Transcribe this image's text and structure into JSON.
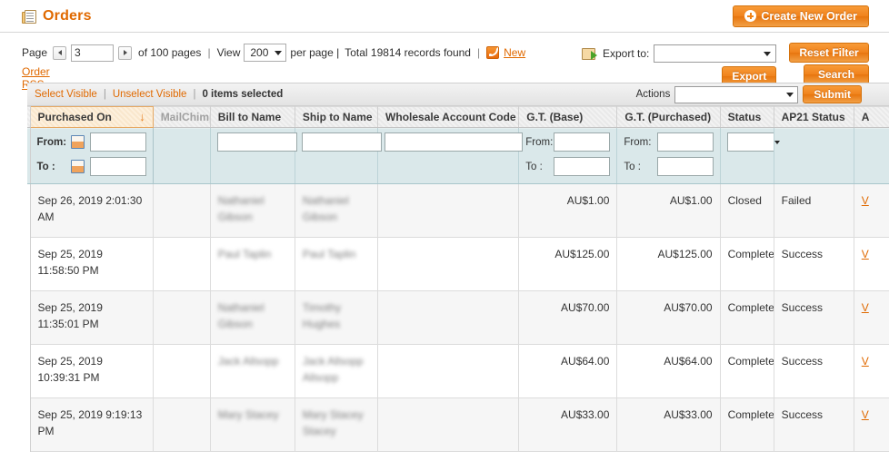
{
  "header": {
    "title": "Orders",
    "icon": "orders-page-icon",
    "create_button": "Create New Order"
  },
  "pager": {
    "page_label": "Page",
    "prev_icon": "prev-page-icon",
    "next_icon": "next-page-icon",
    "page_value": "3",
    "of_pages": "of 100 pages",
    "sep": "|",
    "view_label": "View",
    "per_page_value": "200",
    "per_page_label": "per page |",
    "total_records": "Total 19814 records found",
    "sep2": "|",
    "rss_new": "New",
    "order_rss": "Order RSS"
  },
  "export": {
    "icon": "export-icon",
    "label": "Export to:",
    "select_value": "",
    "button": "Export"
  },
  "filter_buttons": {
    "reset": "Reset Filter",
    "search": "Search"
  },
  "massaction": {
    "select_visible": "Select Visible",
    "divider": "|",
    "unselect_visible": "Unselect Visible",
    "divider2": "|",
    "items_selected": "0 items selected",
    "actions_label": "Actions",
    "actions_value": "",
    "submit": "Submit"
  },
  "grid": {
    "columns": [
      {
        "label": "Purchased On",
        "sorted": true,
        "sort_dir": "↓",
        "muted": false
      },
      {
        "label": "MailChimp",
        "sorted": false,
        "muted": true
      },
      {
        "label": "Bill to Name",
        "sorted": false,
        "muted": false
      },
      {
        "label": "Ship to Name",
        "sorted": false,
        "muted": false
      },
      {
        "label": "Wholesale Account Code",
        "sorted": false,
        "muted": false
      },
      {
        "label": "G.T. (Base)",
        "sorted": false,
        "muted": false
      },
      {
        "label": "G.T. (Purchased)",
        "sorted": false,
        "muted": false
      },
      {
        "label": "Status",
        "sorted": false,
        "muted": false
      },
      {
        "label": "AP21 Status",
        "sorted": false,
        "muted": false
      },
      {
        "label": "A",
        "sorted": false,
        "muted": false
      }
    ],
    "filters": {
      "from_label": "From:",
      "to_label": "To :",
      "date_from": "",
      "date_to": "",
      "bill_to_name": "",
      "ship_to_name": "",
      "wholesale_account_code": "",
      "gt_base_from": "",
      "gt_base_to": "",
      "gt_purchased_from": "",
      "gt_purchased_to": "",
      "status": ""
    },
    "rows": [
      {
        "purchased_on": "Sep 26, 2019 2:01:30 AM",
        "mailchimp": "",
        "bill_to_name": "Nathaniel Gibson",
        "ship_to_name": "Nathaniel Gibson",
        "wholesale_account_code": "",
        "gt_base": "AU$1.00",
        "gt_purchased": "AU$1.00",
        "status": "Closed",
        "ap21_status": "Failed",
        "action": "V"
      },
      {
        "purchased_on": "Sep 25, 2019 11:58:50 PM",
        "mailchimp": "",
        "bill_to_name": "Paul Taplin",
        "ship_to_name": "Paul Taplin",
        "wholesale_account_code": "",
        "gt_base": "AU$125.00",
        "gt_purchased": "AU$125.00",
        "status": "Complete",
        "ap21_status": "Success",
        "action": "V"
      },
      {
        "purchased_on": "Sep 25, 2019 11:35:01 PM",
        "mailchimp": "",
        "bill_to_name": "Nathaniel Gibson",
        "ship_to_name": "Timothy Hughes",
        "wholesale_account_code": "",
        "gt_base": "AU$70.00",
        "gt_purchased": "AU$70.00",
        "status": "Complete",
        "ap21_status": "Success",
        "action": "V"
      },
      {
        "purchased_on": "Sep 25, 2019 10:39:31 PM",
        "mailchimp": "",
        "bill_to_name": "Jack Allsopp",
        "ship_to_name": "Jack Allsopp Allsopp",
        "wholesale_account_code": "",
        "gt_base": "AU$64.00",
        "gt_purchased": "AU$64.00",
        "status": "Complete",
        "ap21_status": "Success",
        "action": "V"
      },
      {
        "purchased_on": "Sep 25, 2019 9:19:13 PM",
        "mailchimp": "",
        "bill_to_name": "Mary Stacey",
        "ship_to_name": "Mary Stacey Stacey",
        "wholesale_account_code": "",
        "gt_base": "AU$33.00",
        "gt_purchased": "AU$33.00",
        "status": "Complete",
        "ap21_status": "Success",
        "action": "V"
      }
    ]
  },
  "colors": {
    "accent": "#e06900",
    "button_orange": "#f0821c",
    "filter_row_bg": "#cfe1e4",
    "row_odd_bg": "#f6f6f6",
    "sorted_header_bg": "#fdf0dd"
  }
}
